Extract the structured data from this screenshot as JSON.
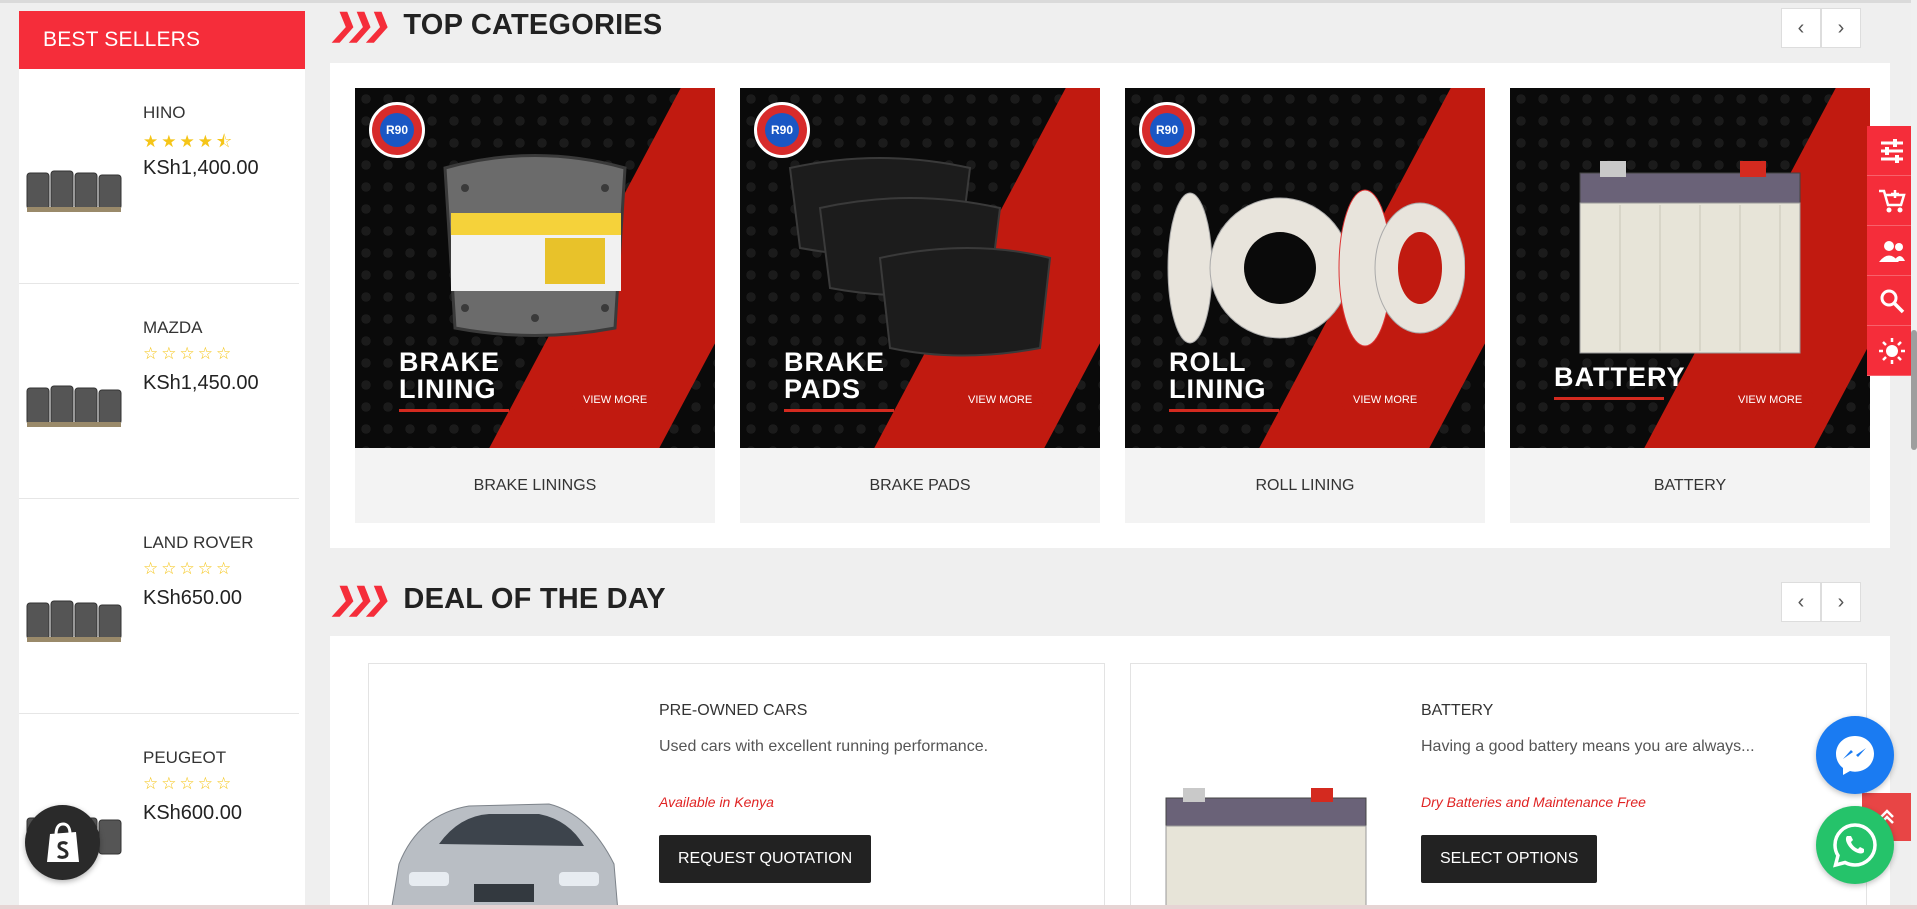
{
  "sidebar": {
    "title": "BEST SELLERS",
    "items": [
      {
        "name": "HINO",
        "rating": 4.5,
        "stars": "★★★★⯪",
        "price": "KSh1,400.00"
      },
      {
        "name": "MAZDA",
        "rating": 0,
        "stars": "☆☆☆☆☆",
        "price": "KSh1,450.00"
      },
      {
        "name": "LAND ROVER",
        "rating": 0,
        "stars": "☆☆☆☆☆",
        "price": "KSh650.00"
      },
      {
        "name": "PEUGEOT",
        "rating": 0,
        "stars": "☆☆☆☆☆",
        "price": "KSh600.00"
      }
    ]
  },
  "top_categories": {
    "title": "TOP CATEGORIES",
    "prev_icon": "‹",
    "next_icon": "›",
    "badge_text": "R90",
    "view_more": "VIEW MORE",
    "cards": [
      {
        "banner_line1": "BRAKE",
        "banner_line2": "LINING",
        "label": "BRAKE LININGS",
        "badge": true
      },
      {
        "banner_line1": "BRAKE",
        "banner_line2": "PADS",
        "label": "BRAKE PADS",
        "badge": true
      },
      {
        "banner_line1": "ROLL",
        "banner_line2": "LINING",
        "label": "ROLL LINING",
        "badge": true
      },
      {
        "banner_line1": "BATTERY",
        "banner_line2": "",
        "label": "BATTERY",
        "badge": false
      }
    ]
  },
  "deal_of_the_day": {
    "title": "DEAL OF THE DAY",
    "prev_icon": "‹",
    "next_icon": "›",
    "cards": [
      {
        "title": "PRE-OWNED CARS",
        "description": "Used cars with excellent running performance.",
        "note": "Available in Kenya",
        "button": "REQUEST QUOTATION"
      },
      {
        "title": "BATTERY",
        "description": "Having a good battery means you are always...",
        "note": "Dry Batteries and Maintenance Free",
        "button": "SELECT OPTIONS"
      }
    ]
  },
  "right_bar": {
    "icons": [
      "filter-sliders-icon",
      "cart-add-icon",
      "account-icon",
      "search-icon",
      "brightness-icon"
    ]
  },
  "colors": {
    "accent": "#f52d3a",
    "dark_button": "#222222",
    "messenger": "#1a7bf2",
    "whatsapp": "#25c36a"
  }
}
